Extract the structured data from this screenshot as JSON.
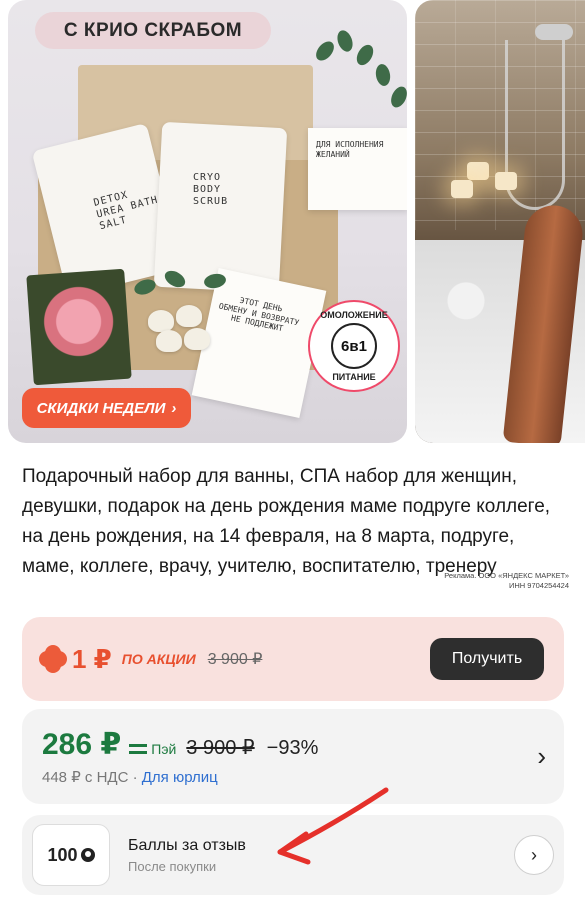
{
  "gallery": {
    "promo_chip": "С КРИО СКРАБОМ",
    "sale_badge": "СКИДКИ НЕДЕЛИ",
    "sale_badge_chevron": "›",
    "pouch_left": "DETOX\nUREA BATH\nSALT",
    "pouch_right": "CRYO\nBODY\nSCRUB",
    "card_wishes": "ДЛЯ ИСПОЛНЕНИЯ\nЖЕЛАНИЙ",
    "card_day": "ЭТОТ ДЕНЬ\nОБМЕНУ И ВОЗВРАТУ\nНЕ ПОДЛЕЖИТ",
    "seal_center": "6в1",
    "seal_top": "ОМОЛОЖЕНИЕ",
    "seal_bottom": "ПИТАНИЕ"
  },
  "product": {
    "title": "Подарочный набор для ванны, СПА набор для женщин, девушки, подарок на день рождения маме подруге коллеге, на день рождения, на 14 февраля, на 8 марта, подруге, маме, коллеге, врачу, учителю, воспитателю, тренеру",
    "ad_line1": "Реклама. ООО «ЯНДЕКС МАРКЕТ»",
    "ad_line2": "ИНН 9704254424"
  },
  "promo": {
    "price": "1 ₽",
    "tag": "ПО АКЦИИ",
    "old_price": "3 900 ₽",
    "button": "Получить"
  },
  "pricing": {
    "price": "286 ₽",
    "pay_label": "Пэй",
    "old_price": "3 900 ₽",
    "discount": "−93%",
    "vat_price": "448 ₽ с НДС",
    "separator": "·",
    "legal_link": "Для юрлиц",
    "chevron": "›"
  },
  "review": {
    "points": "100",
    "title": "Баллы за отзыв",
    "subtitle": "После покупки",
    "chevron": "›"
  },
  "colors": {
    "accent_red": "#e8502f",
    "price_green": "#1c7a3f",
    "link_blue": "#2f6fd0",
    "promo_bg": "#f9e1de"
  }
}
